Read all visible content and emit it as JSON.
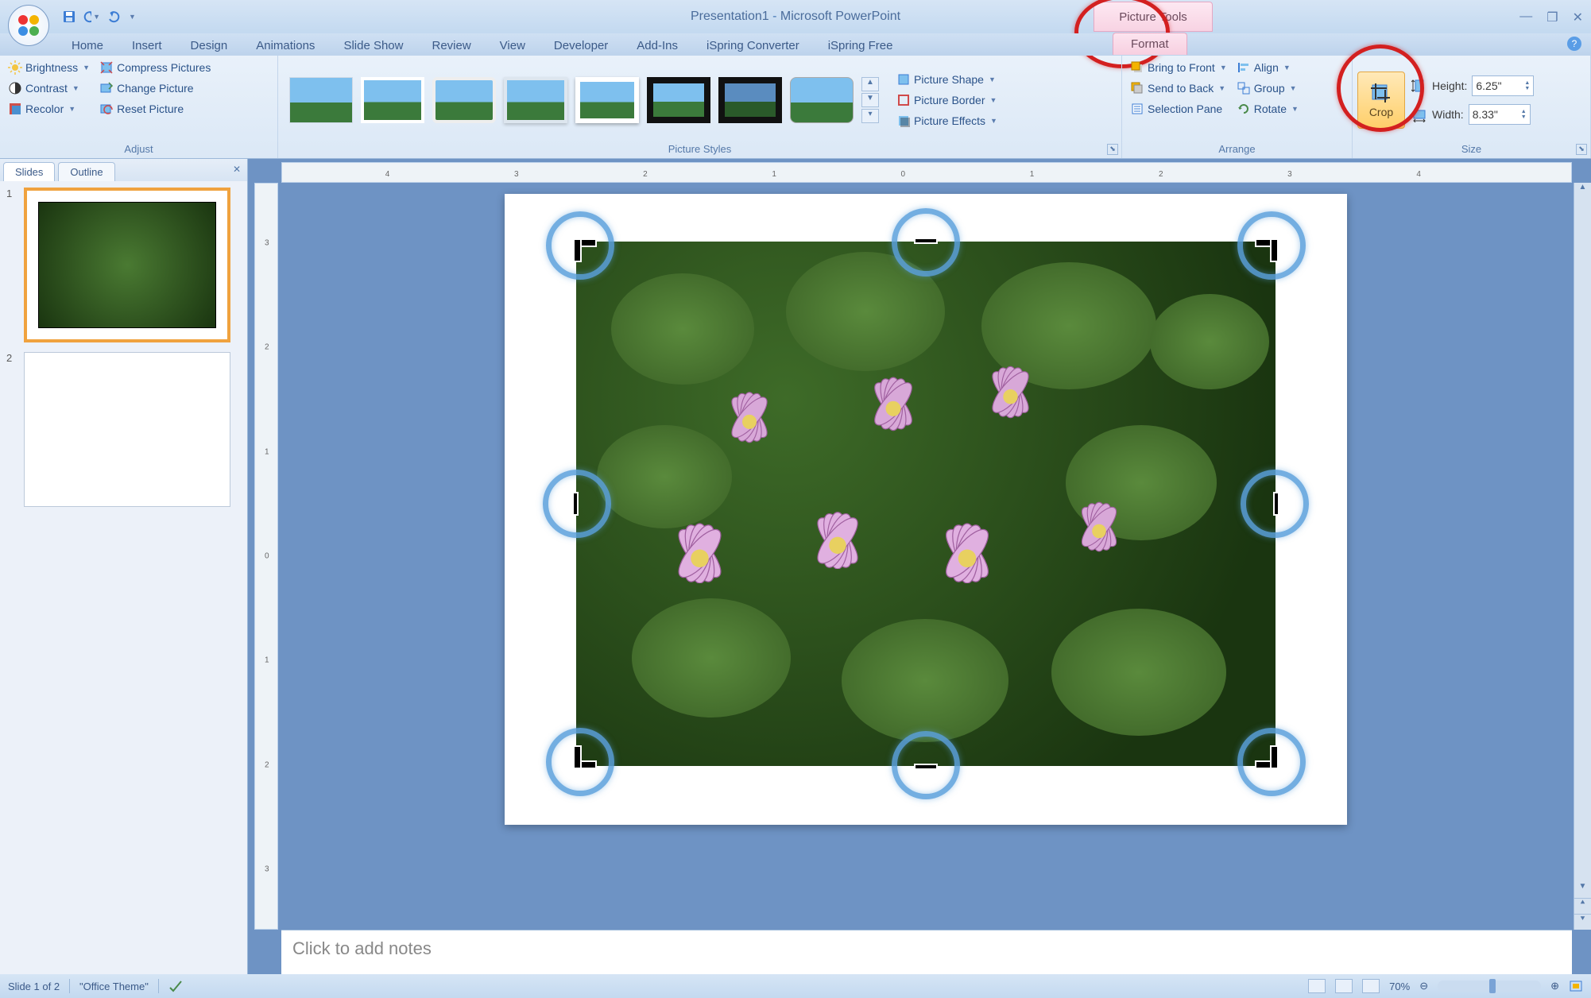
{
  "title": {
    "doc": "Presentation1",
    "sep": " - ",
    "app": "Microsoft PowerPoint"
  },
  "contextual_tab": "Picture Tools",
  "tabs": [
    "Home",
    "Insert",
    "Design",
    "Animations",
    "Slide Show",
    "Review",
    "View",
    "Developer",
    "Add-Ins",
    "iSpring Converter",
    "iSpring Free"
  ],
  "active_tab": "Format",
  "ribbon": {
    "adjust": {
      "label": "Adjust",
      "items_left": [
        "Brightness",
        "Contrast",
        "Recolor"
      ],
      "items_right": [
        "Compress Pictures",
        "Change Picture",
        "Reset Picture"
      ]
    },
    "picture_styles": {
      "label": "Picture Styles",
      "shape": "Picture Shape",
      "border": "Picture Border",
      "effects": "Picture Effects"
    },
    "arrange": {
      "label": "Arrange",
      "bring_front": "Bring to Front",
      "send_back": "Send to Back",
      "selection_pane": "Selection Pane",
      "align": "Align",
      "group": "Group",
      "rotate": "Rotate"
    },
    "size": {
      "label": "Size",
      "crop": "Crop",
      "height_label": "Height:",
      "height_value": "6.25\"",
      "width_label": "Width:",
      "width_value": "8.33\""
    }
  },
  "pane_tabs": {
    "slides": "Slides",
    "outline": "Outline"
  },
  "notes_placeholder": "Click to add notes",
  "status": {
    "slide": "Slide 1 of 2",
    "theme": "\"Office Theme\"",
    "zoom": "70%"
  },
  "ruler_nums": [
    "4",
    "3",
    "2",
    "1",
    "0",
    "1",
    "2",
    "3",
    "4"
  ],
  "vruler_nums": [
    "3",
    "2",
    "1",
    "0",
    "1",
    "2",
    "3"
  ]
}
